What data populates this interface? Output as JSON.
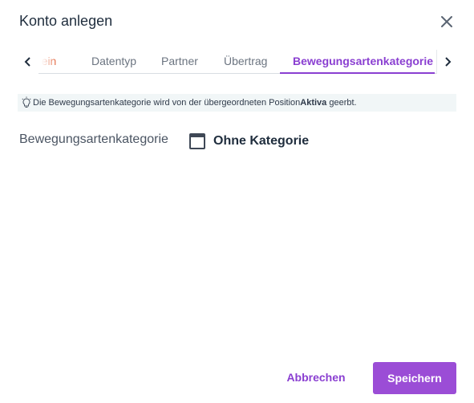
{
  "dialog": {
    "title": "Konto anlegen",
    "close_icon": "close-icon"
  },
  "tabs": [
    {
      "label": "mein",
      "state": "partially-visible"
    },
    {
      "label": "Datentyp"
    },
    {
      "label": "Partner"
    },
    {
      "label": "Übertrag"
    },
    {
      "label": "Bewegungsartenkategorie",
      "state": "active"
    }
  ],
  "tab_scroll": {
    "left_icon": "chevron-left-icon",
    "right_icon": "chevron-right-icon"
  },
  "info": {
    "icon": "lightbulb-icon",
    "text_before": "Die Bewegungsartenkategorie wird von der übergeordneten Position ",
    "text_bold": "Aktiva",
    "text_after": " geerbt."
  },
  "field": {
    "label": "Bewegungsartenkategorie",
    "checkbox_label": "Ohne Kategorie",
    "checkbox_state": "indeterminate"
  },
  "buttons": {
    "cancel": "Abbrechen",
    "save": "Speichern"
  },
  "colors": {
    "accent": "#8a3fd1",
    "primary_button": "#9b4dd6",
    "partial_tab": "#e0582e",
    "info_background": "#f1f6f7"
  }
}
